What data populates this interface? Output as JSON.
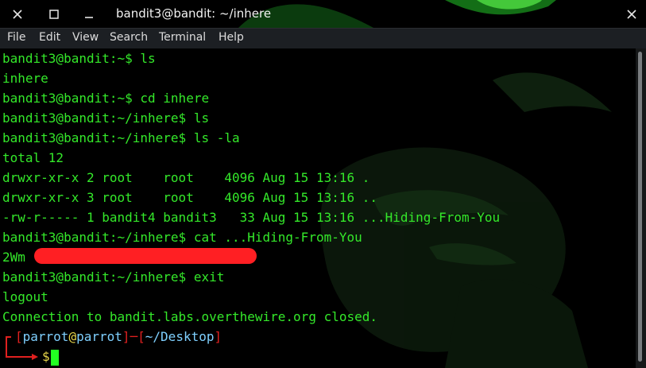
{
  "window": {
    "title": "bandit3@bandit: ~/inhere",
    "close_icon": "close-icon",
    "maximize_icon": "maximize-icon",
    "minimize_icon": "minimize-icon"
  },
  "menu": [
    "File",
    "Edit",
    "View",
    "Search",
    "Terminal",
    "Help"
  ],
  "terminal": {
    "lines": [
      "bandit3@bandit:~$ ls",
      "inhere",
      "bandit3@bandit:~$ cd inhere",
      "bandit3@bandit:~/inhere$ ls",
      "bandit3@bandit:~/inhere$ ls -la",
      "total 12",
      "drwxr-xr-x 2 root    root    4096 Aug 15 13:16 .",
      "drwxr-xr-x 3 root    root    4096 Aug 15 13:16 ..",
      "-rw-r----- 1 bandit4 bandit3   33 Aug 15 13:16 ...Hiding-From-You",
      "bandit3@bandit:~/inhere$ cat ...Hiding-From-You",
      "2Wm",
      "bandit3@bandit:~/inhere$ exit",
      "logout",
      "Connection to bandit.labs.overthewire.org closed."
    ],
    "prompt": {
      "open_frame": "┌─[",
      "user": "parrot",
      "at": "@",
      "host": "parrot",
      "mid": "]─[",
      "path": "~/Desktop",
      "close": "]",
      "dollar": "$"
    }
  },
  "colors": {
    "terminal_text": "#34e82a",
    "prompt_frame": "#e0201f",
    "prompt_user": "#7fd0ff",
    "prompt_dollar": "#e8d64a",
    "cursor": "#22ff22",
    "redaction": "#ff1f23"
  }
}
